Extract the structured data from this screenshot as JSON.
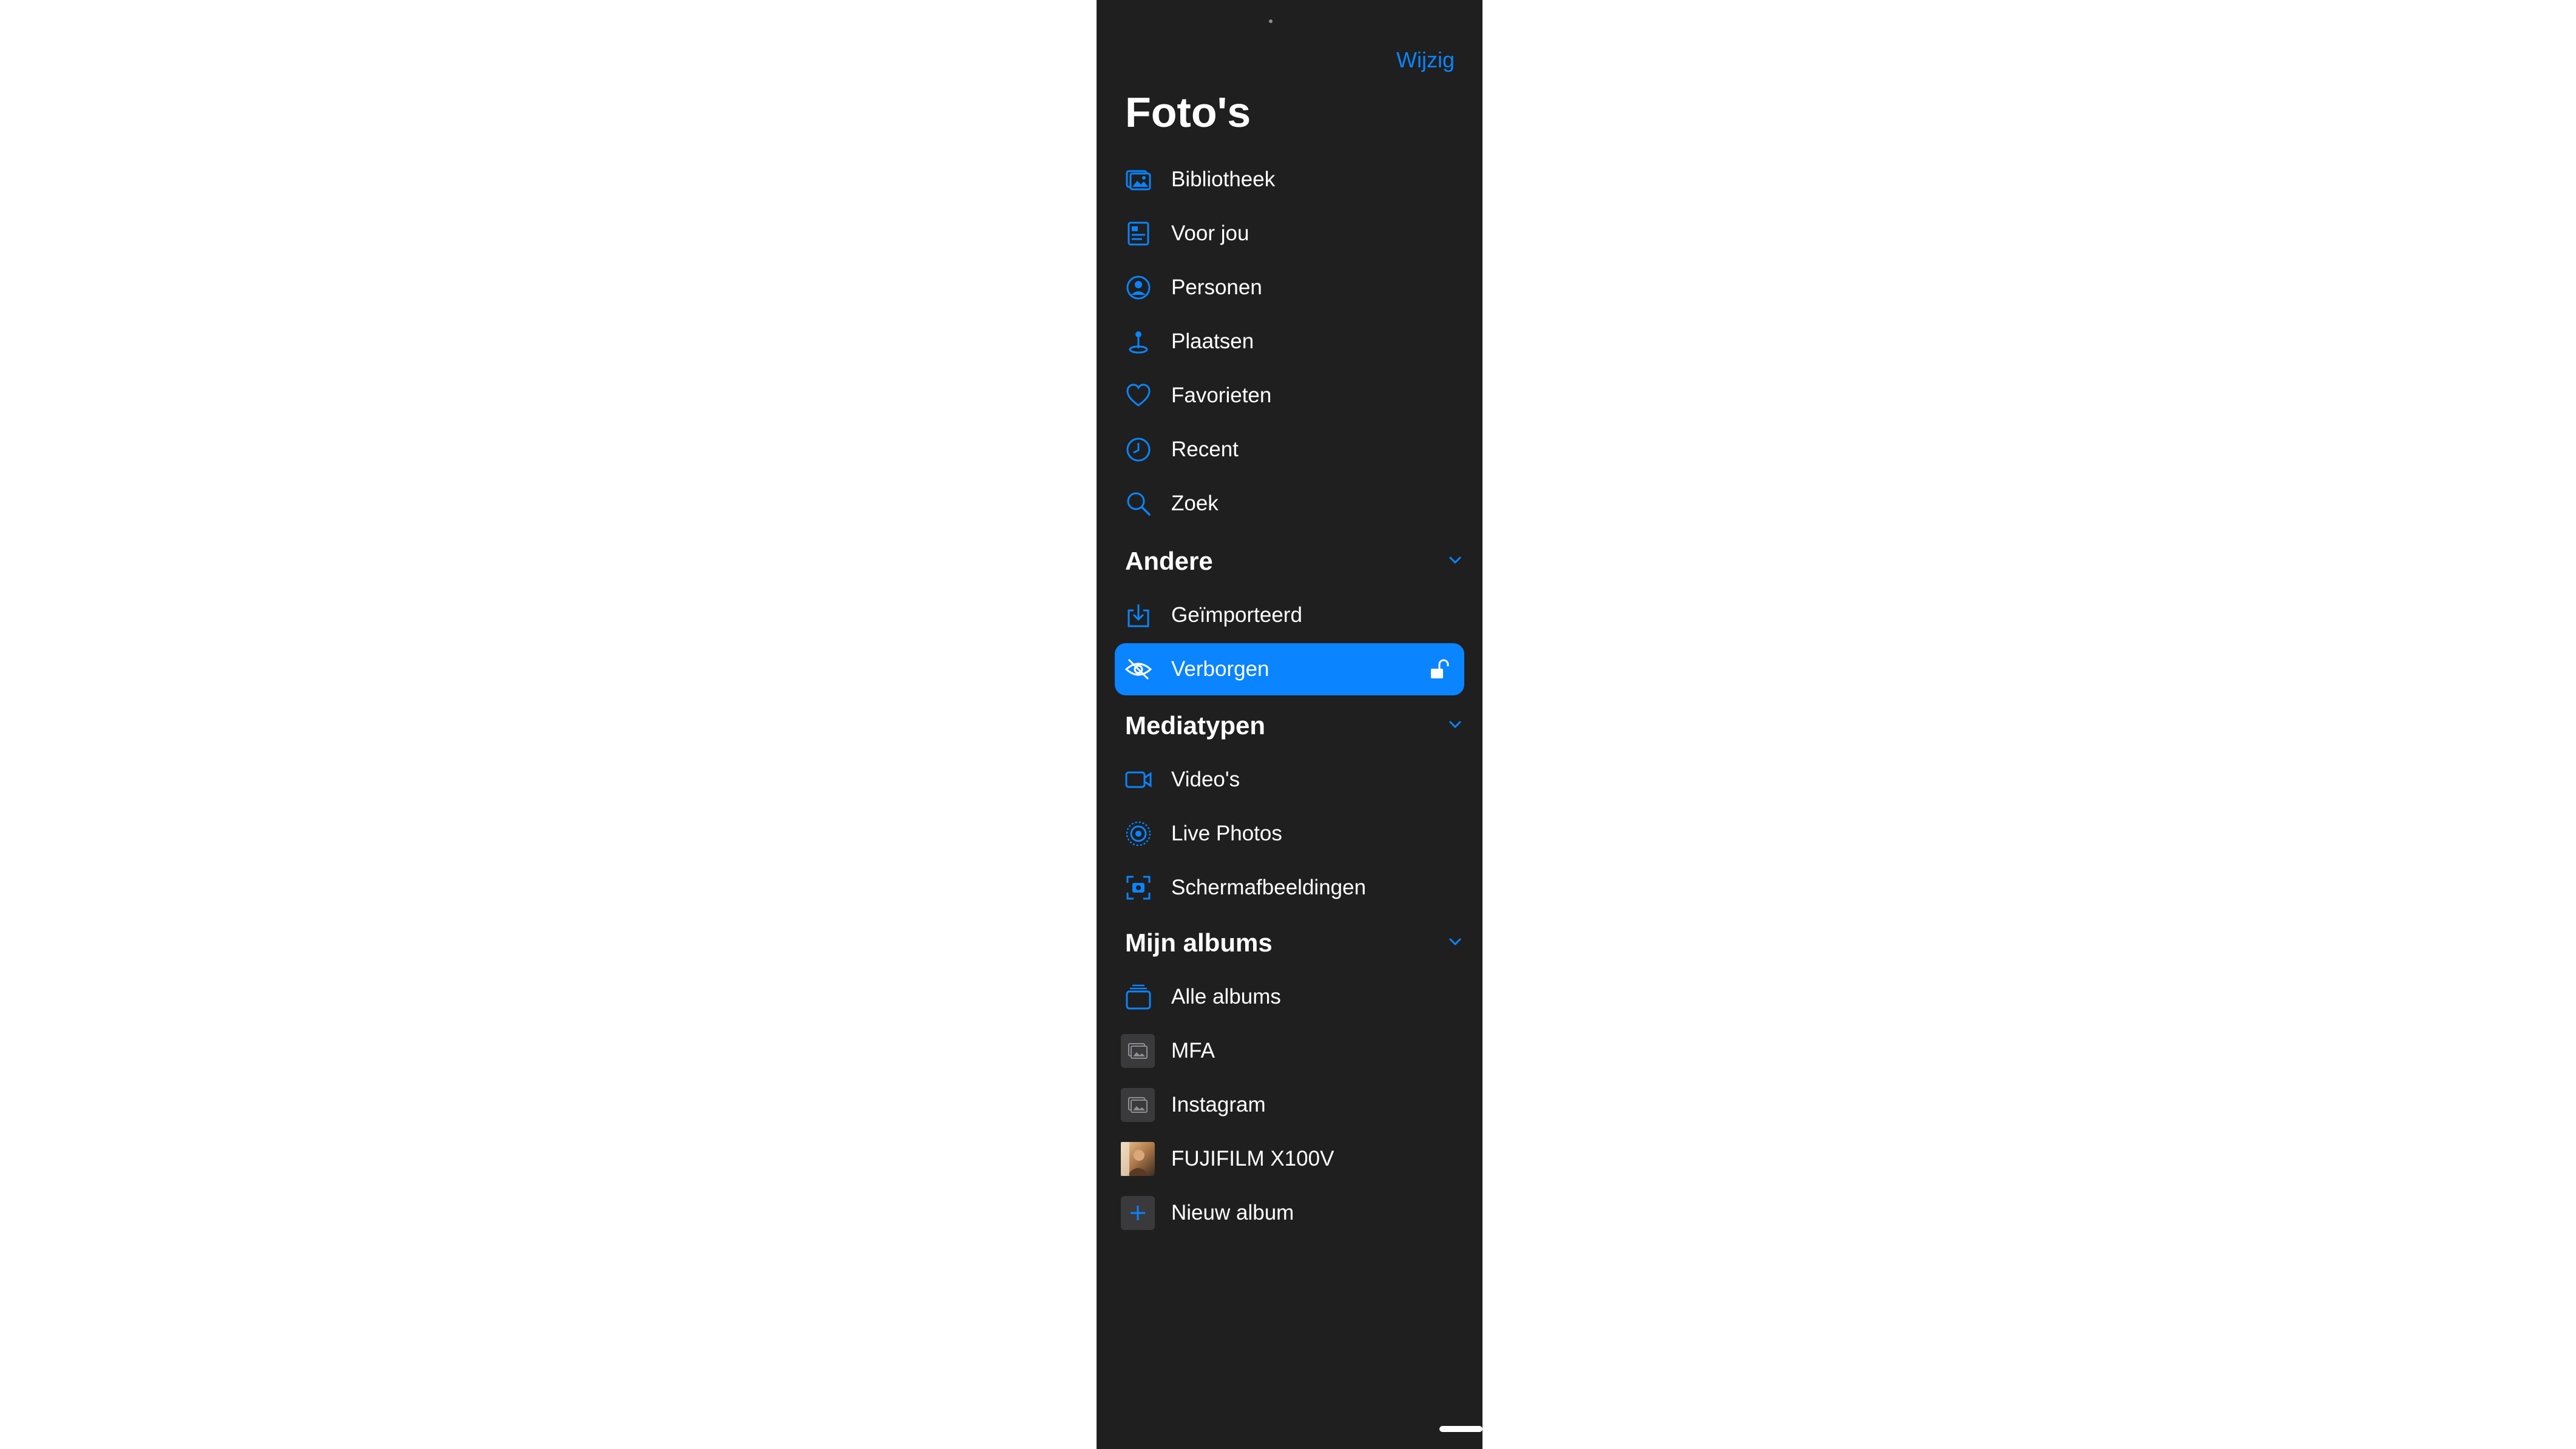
{
  "header": {
    "edit_label": "Wijzig",
    "title": "Foto's"
  },
  "library": [
    {
      "label": "Bibliotheek",
      "icon": "photo-library-icon"
    },
    {
      "label": "Voor jou",
      "icon": "for-you-icon"
    },
    {
      "label": "Personen",
      "icon": "person-circle-icon"
    },
    {
      "label": "Plaatsen",
      "icon": "map-pin-icon"
    },
    {
      "label": "Favorieten",
      "icon": "heart-icon"
    },
    {
      "label": "Recent",
      "icon": "clock-icon"
    },
    {
      "label": "Zoek",
      "icon": "search-icon"
    }
  ],
  "sections": {
    "other": {
      "title": "Andere",
      "items": [
        {
          "label": "Geïmporteerd",
          "icon": "import-icon"
        },
        {
          "label": "Verborgen",
          "icon": "eye-slash-icon",
          "selected": true,
          "trailing_icon": "lock-open-icon"
        }
      ]
    },
    "media": {
      "title": "Mediatypen",
      "items": [
        {
          "label": "Video's",
          "icon": "video-icon"
        },
        {
          "label": "Live Photos",
          "icon": "live-photo-icon"
        },
        {
          "label": "Schermafbeeldingen",
          "icon": "screenshot-icon"
        }
      ]
    },
    "albums": {
      "title": "Mijn albums",
      "items": [
        {
          "label": "Alle albums",
          "icon": "albums-stack-icon"
        },
        {
          "label": "MFA",
          "icon": "album-placeholder-icon"
        },
        {
          "label": "Instagram",
          "icon": "album-placeholder-icon"
        },
        {
          "label": "FUJIFILM X100V",
          "icon": "album-photo-thumbnail"
        },
        {
          "label": "Nieuw album",
          "icon": "plus-icon"
        }
      ]
    }
  },
  "colors": {
    "accent": "#0a84ff",
    "background": "#1f1f1f",
    "text": "#ffffff"
  }
}
